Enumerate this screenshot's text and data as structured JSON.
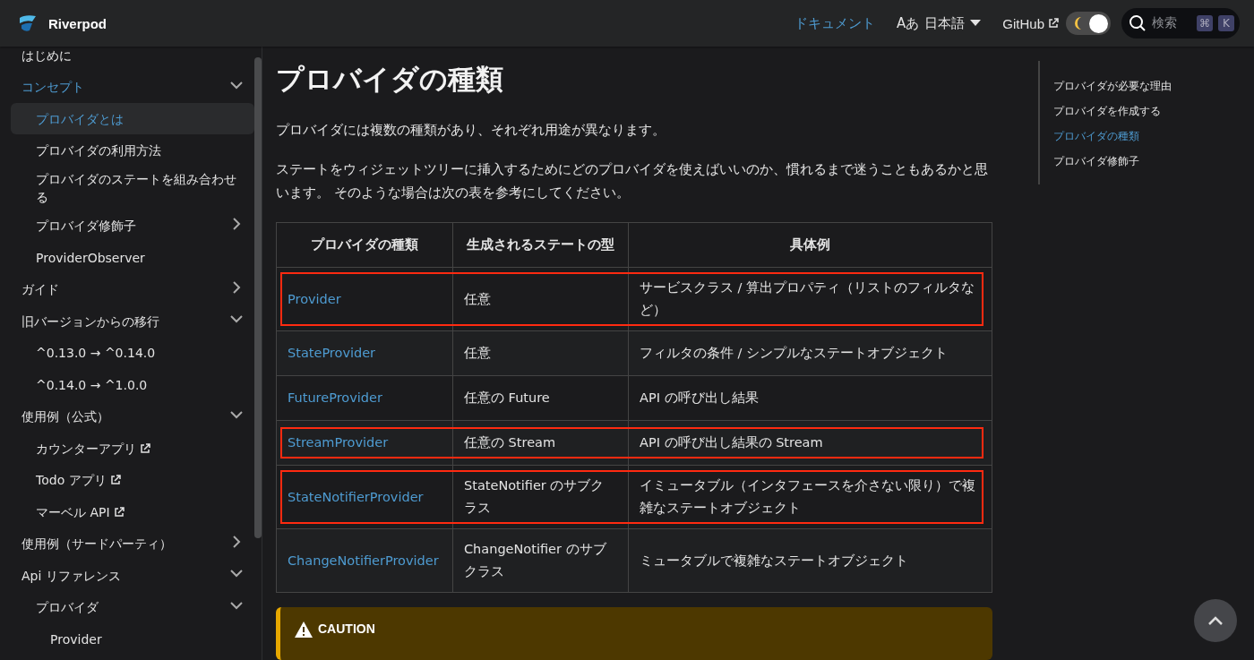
{
  "navbar": {
    "brand": "Riverpod",
    "links": [
      {
        "label": "ドキュメント",
        "selected": true
      }
    ],
    "language": {
      "icon_text": "Aあ",
      "label": "日本語"
    },
    "github": "GitHub",
    "dark_mode": {
      "on": true
    },
    "search": {
      "placeholder": "検索",
      "keys": [
        "⌘",
        "K"
      ]
    }
  },
  "sidebar": {
    "items": [
      {
        "label": "はじめに",
        "selected": false
      },
      {
        "label": "コンセプト",
        "selected": false,
        "expanded": true,
        "children": [
          {
            "label": "プロバイダとは",
            "selected": true
          },
          {
            "label": "プロバイダの利用方法",
            "selected": false
          },
          {
            "label": "プロバイダのステートを組み合わせる",
            "selected": false
          },
          {
            "label": "プロバイダ修飾子",
            "selected": false,
            "expanded": false
          },
          {
            "label": "ProviderObserver",
            "selected": false
          }
        ]
      },
      {
        "label": "ガイド",
        "selected": false,
        "expanded": false
      },
      {
        "label": "旧バージョンからの移行",
        "selected": false,
        "expanded": true,
        "children": [
          {
            "label": "^0.13.0 → ^0.14.0",
            "selected": false
          },
          {
            "label": "^0.14.0 → ^1.0.0",
            "selected": false
          }
        ]
      },
      {
        "label": "使用例（公式）",
        "selected": false,
        "expanded": true,
        "children": [
          {
            "label": "カウンターアプリ",
            "selected": false,
            "external": true
          },
          {
            "label": "Todo アプリ",
            "selected": false,
            "external": true
          },
          {
            "label": "マーベル API",
            "selected": false,
            "external": true
          }
        ]
      },
      {
        "label": "使用例（サードパーティ）",
        "selected": false,
        "expanded": false
      },
      {
        "label": "Api リファレンス",
        "selected": false,
        "expanded": true,
        "children": [
          {
            "label": "プロバイダ",
            "selected": false,
            "expanded": true,
            "children": [
              {
                "label": "Provider",
                "selected": false
              }
            ]
          }
        ]
      }
    ]
  },
  "article": {
    "title": "プロバイダの種類",
    "paragraphs": [
      "プロバイダには複数の種類があり、それぞれ用途が異なります。",
      "ステートをウィジェットツリーに挿入するためにどのプロバイダを使えばいいのか、慣れるまで迷うこともあるかと思います。 そのような場合は次の表を参考にしてください。"
    ],
    "table": {
      "columns": [
        "プロバイダの種類",
        "生成されるステートの型",
        "具体例"
      ],
      "rows": [
        {
          "provider": "Provider",
          "type": "任意",
          "example": "サービスクラス / 算出プロパティ（リストのフィルタなど）",
          "highlighted": true
        },
        {
          "provider": "StateProvider",
          "type": "任意",
          "example": "フィルタの条件 / シンプルなステートオブジェクト",
          "highlighted": false
        },
        {
          "provider": "FutureProvider",
          "type": "任意の Future",
          "example": "API の呼び出し結果",
          "highlighted": false
        },
        {
          "provider": "StreamProvider",
          "type": "任意の Stream",
          "example": "API の呼び出し結果の Stream",
          "highlighted": true
        },
        {
          "provider": "StateNotifierProvider",
          "type": "StateNotifier のサブクラス",
          "example": "イミュータブル（インタフェースを介さない限り）で複雑なステートオブジェクト",
          "highlighted": true
        },
        {
          "provider": "ChangeNotifierProvider",
          "type": "ChangeNotifier のサブクラス",
          "example": "ミュータブルで複雑なステートオブジェクト",
          "highlighted": false
        }
      ]
    },
    "admonition": {
      "kind": "caution",
      "title": "CAUTION"
    }
  },
  "toc": {
    "items": [
      {
        "label": "プロバイダが必要な理由",
        "selected": false
      },
      {
        "label": "プロバイダを作成する",
        "selected": false
      },
      {
        "label": "プロバイダの種類",
        "selected": true
      },
      {
        "label": "プロバイダ修飾子",
        "selected": false
      }
    ]
  }
}
